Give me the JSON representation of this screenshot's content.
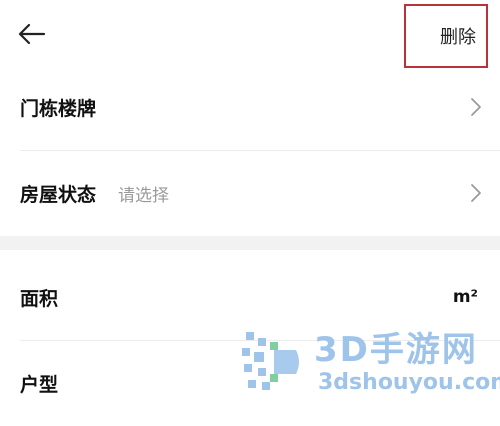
{
  "header": {
    "back_icon": "arrow-left-icon",
    "delete_label": "删除"
  },
  "fields": {
    "door_number": {
      "label": "门栋楼牌",
      "chevron": "chevron-right-icon"
    },
    "house_status": {
      "label": "房屋状态",
      "placeholder": "请选择",
      "chevron": "chevron-right-icon"
    },
    "area": {
      "label": "面积",
      "unit": "m²"
    },
    "layout": {
      "label": "户型"
    }
  },
  "watermark": {
    "title": "3D手游网",
    "domain": "3dshouyou.com",
    "color": "#9ec4ea"
  },
  "colors": {
    "highlight_border": "#b8323a",
    "section_gap": "#f2f2f2",
    "placeholder_text": "#9a9a9a"
  }
}
